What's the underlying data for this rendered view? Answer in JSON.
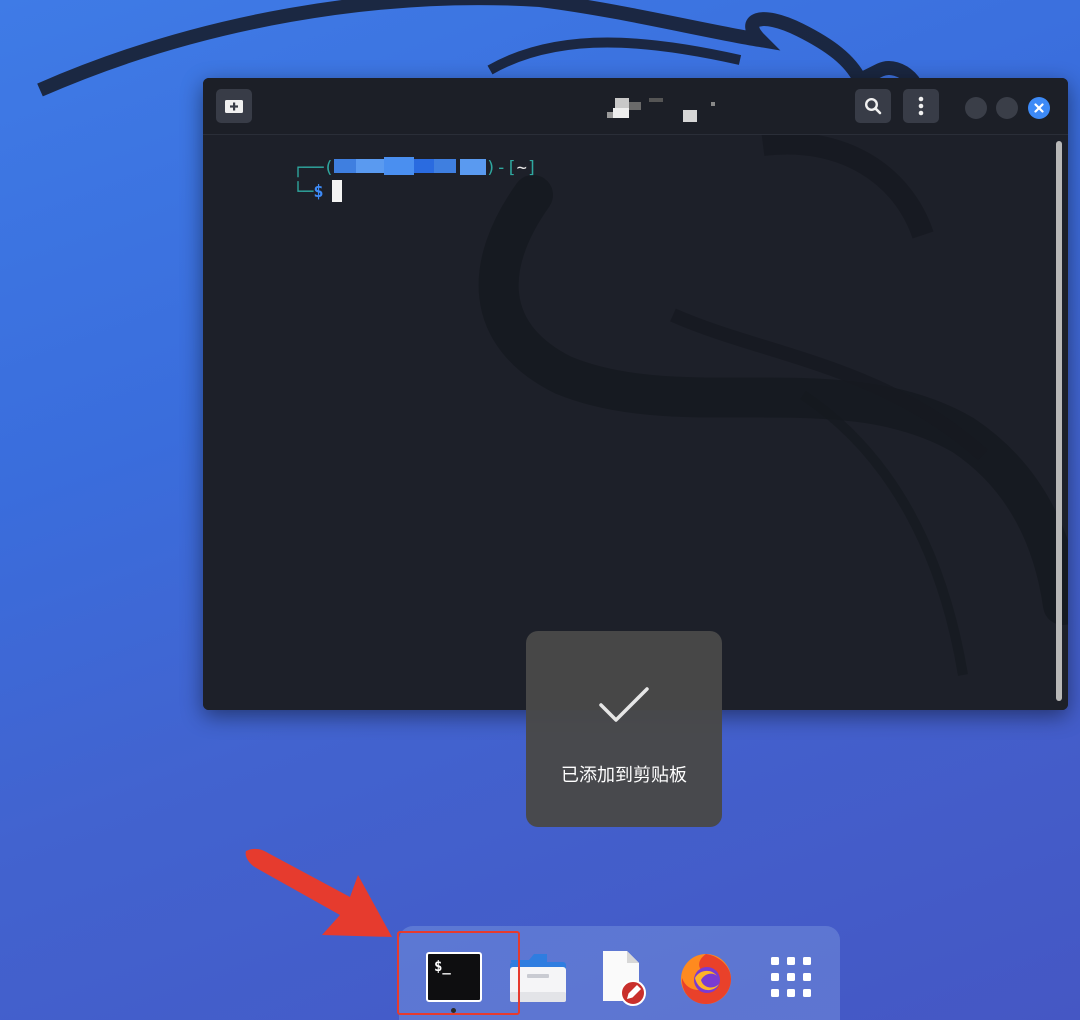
{
  "terminal": {
    "prompt_open": "┌──(",
    "prompt_close": ")-[",
    "cwd": "~",
    "prompt_end": "]",
    "prompt_second_line": "└─",
    "dollar": "$"
  },
  "toast": {
    "message": "已添加到剪贴板"
  },
  "dock": {
    "items": [
      "terminal-icon",
      "file-manager-icon",
      "text-editor-icon",
      "firefox-icon",
      "app-grid-icon"
    ],
    "terminal_glyph": "$_"
  },
  "icons": {
    "new_tab": "new-tab-icon",
    "search": "search-icon",
    "menu": "kebab-menu-icon",
    "minimize": "minimize-icon",
    "maximize": "maximize-icon",
    "close": "close-icon",
    "check": "checkmark-icon"
  },
  "colors": {
    "accent": "#3d8af7",
    "prompt": "#2fa8a0",
    "highlight": "#e63b2e"
  }
}
